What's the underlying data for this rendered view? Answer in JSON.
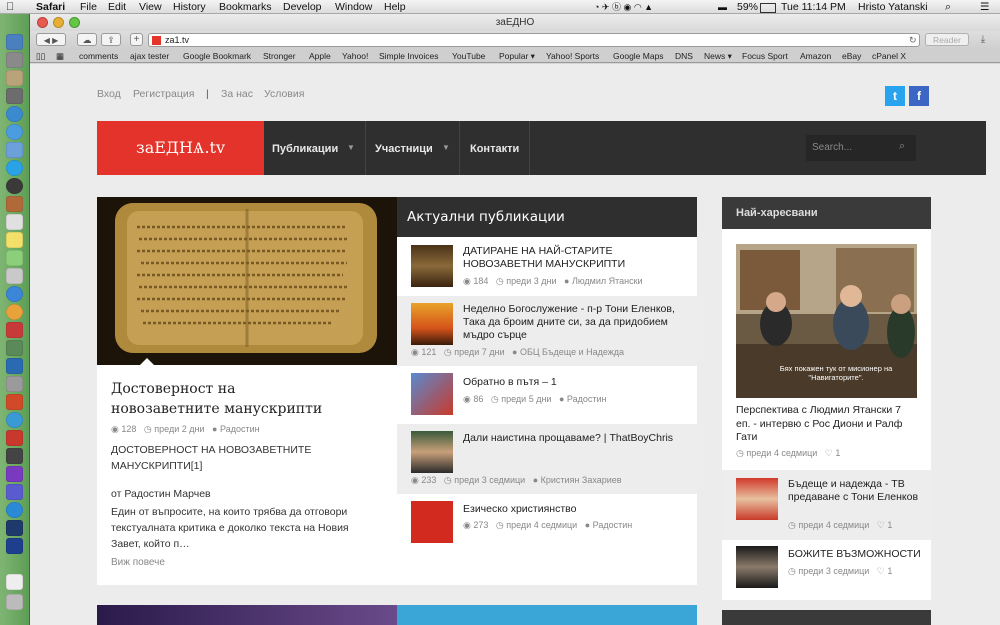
{
  "menubar": {
    "app": "Safari",
    "menus": [
      "File",
      "Edit",
      "View",
      "History",
      "Bookmarks",
      "Develop",
      "Window",
      "Help"
    ],
    "battery": "59%",
    "clock": "Tue 11:14 PM",
    "user": "Hristo Yatanski"
  },
  "browser": {
    "window_title": "заЕДНО",
    "url": "za1.tv",
    "reader_label": "Reader",
    "bookmarks": [
      "comments",
      "ajax tester",
      "Google Bookmark",
      "Stronger",
      "Apple",
      "Yahoo!",
      "Simple Invoices",
      "YouTube",
      "Popular",
      "Yahoo! Sports",
      "Google Maps",
      "DNS",
      "News",
      "Focus Sport",
      "Amazon",
      "eBay",
      "cPanel X"
    ]
  },
  "site": {
    "toplinks": {
      "login": "Вход",
      "register": "Регистрация",
      "sep": "|",
      "about": "За нас",
      "terms": "Условия"
    },
    "social": {
      "twitter": "t",
      "facebook": "f"
    },
    "logo": "заЕДНѦ.tv",
    "nav": {
      "publications": "Публикации",
      "participants": "Участници",
      "contacts": "Контакти"
    },
    "search_placeholder": "Search..."
  },
  "featured": {
    "title": "Достоверност на новозаветните манускрипти",
    "views": "128",
    "date": "преди 2 дни",
    "author": "Радостин",
    "excerpt_heading": "ДОСТОВЕРНОСТ НА НОВОЗАВЕТНИТЕ МАНУСКРИПТИ[1]",
    "byline": "от Радостин Марчев",
    "excerpt": "Един от въпросите, на които трябва да отговори текстуалната критика е доколко текста на Новия Завет, който п…",
    "more": "Виж повече"
  },
  "current": {
    "heading": "Актуални публикации",
    "items": [
      {
        "title": "ДАТИРАНЕ НА НАЙ-СТАРИТЕ НОВОЗАВЕТНИ МАНУСКРИПТИ",
        "views": "184",
        "date": "преди 3 дни",
        "author": "Людмил Ятански"
      },
      {
        "title": "Неделно Богослужение - п-р Тони Еленков, Така да броим дните си, за да придобием мъдро сърце",
        "views": "121",
        "date": "преди 7 дни",
        "author": "ОБЦ Бъдеще и Надежда"
      },
      {
        "title": "Обратно в пътя – 1",
        "views": "86",
        "date": "преди 5 дни",
        "author": "Радостин"
      },
      {
        "title": "Дали наистина прощаваме? | ThatBoyChris",
        "views": "233",
        "date": "преди 3 седмици",
        "author": "Кристиян Захариев"
      },
      {
        "title": "Езическо християнство",
        "views": "273",
        "date": "преди 4 седмици",
        "author": "Радостин"
      }
    ]
  },
  "popular": {
    "heading": "Най-харесвани",
    "video_caption": "Бях покажен тук от мисионер на \"Навигаторите\".",
    "featured_title": "Перспектива с Людмил Ятански 7 еп. - интервю с Рос Диони и Ралф Гати",
    "featured_date": "преди 4 седмици",
    "featured_likes": "1",
    "items": [
      {
        "title": "Бъдеще и надежда - ТВ предаване с Тони Еленков",
        "date": "преди 4 седмици",
        "likes": "1"
      },
      {
        "title": "БОЖИТЕ ВЪЗМОЖНОСТИ",
        "date": "преди 3 седмици",
        "likes": "1"
      }
    ]
  }
}
